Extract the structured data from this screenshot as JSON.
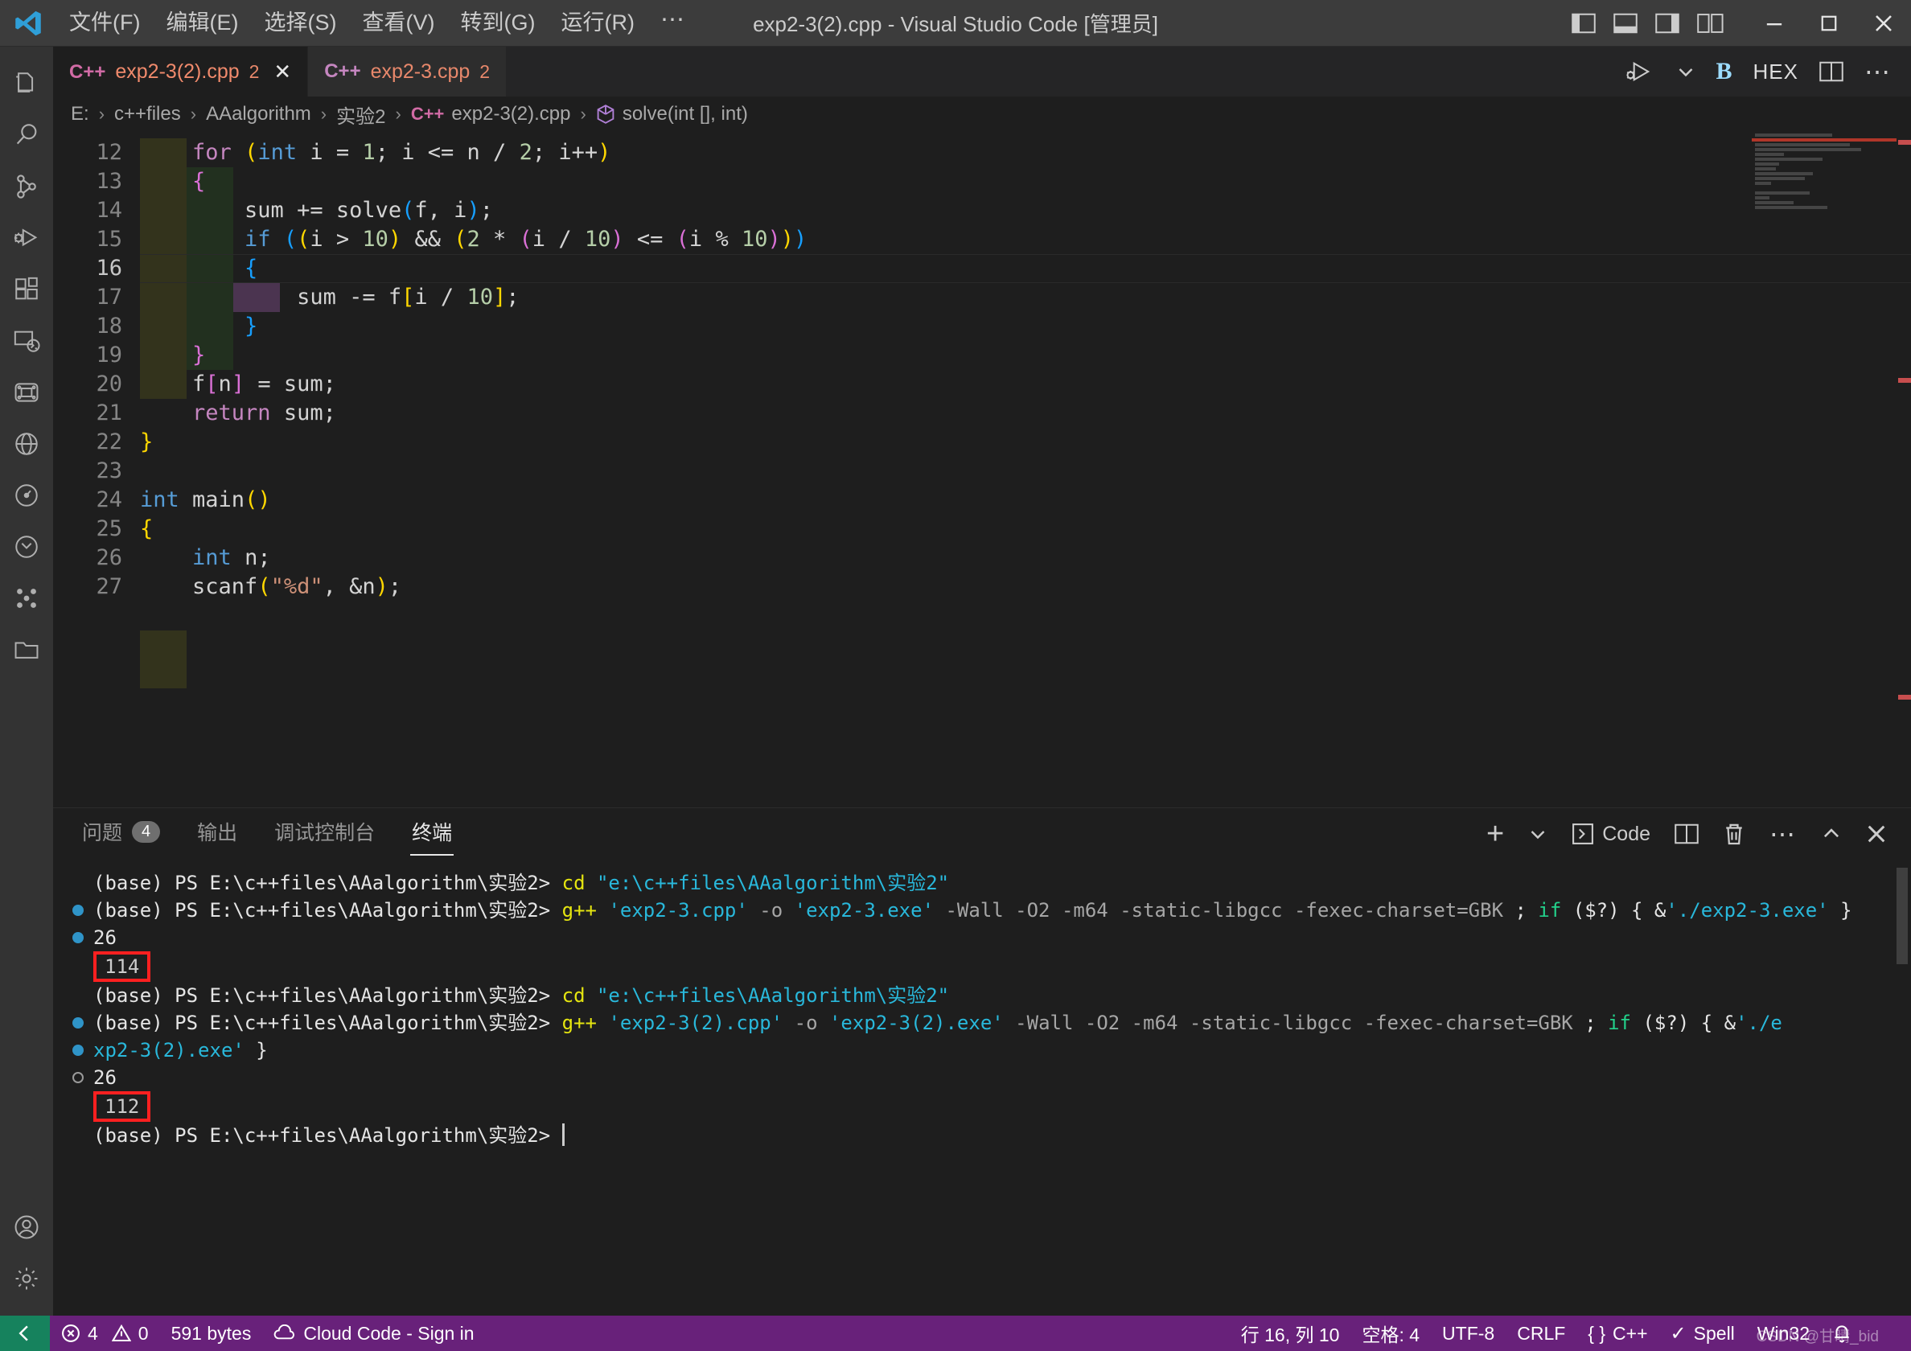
{
  "window": {
    "title": "exp2-3(2).cpp - Visual Studio Code [管理员]",
    "menu": [
      "文件(F)",
      "编辑(E)",
      "选择(S)",
      "查看(V)",
      "转到(G)",
      "运行(R)",
      "⋯"
    ],
    "controls": {
      "minimize": "—",
      "maximize": "▢",
      "close": "✕"
    }
  },
  "activitybar": {
    "items": [
      {
        "name": "explorer-icon",
        "label": "资源管理器"
      },
      {
        "name": "search-icon",
        "label": "搜索"
      },
      {
        "name": "source-control-icon",
        "label": "源代码管理"
      },
      {
        "name": "run-debug-icon",
        "label": "运行和调试"
      },
      {
        "name": "extensions-icon",
        "label": "扩展"
      },
      {
        "name": "remote-explorer-icon",
        "label": "远程资源管理器"
      },
      {
        "name": "testing-icon",
        "label": "测试"
      },
      {
        "name": "cloud-code-icon",
        "label": "Cloud Code"
      },
      {
        "name": "gauge-icon",
        "label": "性能"
      },
      {
        "name": "beaker-icon",
        "label": "实验"
      },
      {
        "name": "blocks-icon",
        "label": "模块"
      },
      {
        "name": "folder-icon",
        "label": "文件夹"
      },
      {
        "name": "account-icon",
        "label": "账户"
      },
      {
        "name": "settings-gear-icon",
        "label": "管理"
      }
    ]
  },
  "tabs": [
    {
      "icon_label": "C++",
      "name": "exp2-3(2).cpp",
      "problems": "2",
      "active": true,
      "close": "✕"
    },
    {
      "icon_label": "C++",
      "name": "exp2-3.cpp",
      "problems": "2",
      "active": false,
      "close": ""
    }
  ],
  "editor_actions": [
    {
      "name": "run-and-debug-icon",
      "label": "运行和调试"
    },
    {
      "name": "chevron-down-icon",
      "label": "更多运行选项"
    },
    {
      "name": "bold-b-icon",
      "label": "B"
    },
    {
      "name": "hex-editor-icon",
      "label": "HEX"
    },
    {
      "name": "split-editor-icon",
      "label": "拆分编辑器"
    },
    {
      "name": "more-actions-icon",
      "label": "⋯"
    }
  ],
  "breadcrumb": {
    "parts": [
      "E:",
      "c++files",
      "AAalgorithm",
      "实验2",
      "exp2-3(2).cpp",
      "solve(int [], int)"
    ],
    "separator": "›",
    "file_icon": "C++",
    "symbol_icon": "method-symbol-icon"
  },
  "code": {
    "first_line": 12,
    "lines": [
      {
        "n": 12,
        "tokens": [
          {
            "t": "    ",
            "c": "plain"
          },
          {
            "t": "for",
            "c": "ctrl"
          },
          {
            "t": " ",
            "c": "plain"
          },
          {
            "t": "(",
            "c": "b1"
          },
          {
            "t": "int",
            "c": "blue"
          },
          {
            "t": " i ",
            "c": "plain"
          },
          {
            "t": "=",
            "c": "plain"
          },
          {
            "t": " ",
            "c": "plain"
          },
          {
            "t": "1",
            "c": "num"
          },
          {
            "t": "; i ",
            "c": "plain"
          },
          {
            "t": "<=",
            "c": "plain"
          },
          {
            "t": " n ",
            "c": "plain"
          },
          {
            "t": "/",
            "c": "plain"
          },
          {
            "t": " ",
            "c": "plain"
          },
          {
            "t": "2",
            "c": "num"
          },
          {
            "t": "; i",
            "c": "plain"
          },
          {
            "t": "++",
            "c": "plain"
          },
          {
            "t": ")",
            "c": "b1"
          }
        ]
      },
      {
        "n": 13,
        "tokens": [
          {
            "t": "    ",
            "c": "plain"
          },
          {
            "t": "{",
            "c": "b2"
          }
        ]
      },
      {
        "n": 14,
        "tokens": [
          {
            "t": "        sum ",
            "c": "plain"
          },
          {
            "t": "+=",
            "c": "plain"
          },
          {
            "t": " solve",
            "c": "plain"
          },
          {
            "t": "(",
            "c": "b3"
          },
          {
            "t": "f, i",
            "c": "plain"
          },
          {
            "t": ")",
            "c": "b3"
          },
          {
            "t": ";",
            "c": "plain"
          }
        ]
      },
      {
        "n": 15,
        "tokens": [
          {
            "t": "        ",
            "c": "plain"
          },
          {
            "t": "if",
            "c": "blue"
          },
          {
            "t": " ",
            "c": "plain"
          },
          {
            "t": "(",
            "c": "b3"
          },
          {
            "t": "(",
            "c": "b1"
          },
          {
            "t": "i ",
            "c": "plain"
          },
          {
            "t": ">",
            "c": "plain"
          },
          {
            "t": " ",
            "c": "plain"
          },
          {
            "t": "10",
            "c": "num"
          },
          {
            "t": ")",
            "c": "b1"
          },
          {
            "t": " && ",
            "c": "plain"
          },
          {
            "t": "(",
            "c": "b1"
          },
          {
            "t": "2",
            "c": "num"
          },
          {
            "t": " * ",
            "c": "plain"
          },
          {
            "t": "(",
            "c": "b2"
          },
          {
            "t": "i ",
            "c": "plain"
          },
          {
            "t": "/",
            "c": "plain"
          },
          {
            "t": " ",
            "c": "plain"
          },
          {
            "t": "10",
            "c": "num"
          },
          {
            "t": ")",
            "c": "b2"
          },
          {
            "t": " <= ",
            "c": "plain"
          },
          {
            "t": "(",
            "c": "b2"
          },
          {
            "t": "i ",
            "c": "plain"
          },
          {
            "t": "%",
            "c": "plain"
          },
          {
            "t": " ",
            "c": "plain"
          },
          {
            "t": "10",
            "c": "num"
          },
          {
            "t": ")",
            "c": "b2"
          },
          {
            "t": ")",
            "c": "b1"
          },
          {
            "t": ")",
            "c": "b3"
          }
        ]
      },
      {
        "n": 16,
        "tokens": [
          {
            "t": "        ",
            "c": "plain"
          },
          {
            "t": "{",
            "c": "b3"
          }
        ],
        "current": true
      },
      {
        "n": 17,
        "tokens": [
          {
            "t": "            sum ",
            "c": "plain"
          },
          {
            "t": "-=",
            "c": "plain"
          },
          {
            "t": " f",
            "c": "plain"
          },
          {
            "t": "[",
            "c": "b1"
          },
          {
            "t": "i ",
            "c": "plain"
          },
          {
            "t": "/",
            "c": "plain"
          },
          {
            "t": " ",
            "c": "plain"
          },
          {
            "t": "10",
            "c": "num"
          },
          {
            "t": "]",
            "c": "b1"
          },
          {
            "t": ";",
            "c": "plain"
          }
        ]
      },
      {
        "n": 18,
        "tokens": [
          {
            "t": "        ",
            "c": "plain"
          },
          {
            "t": "}",
            "c": "b3"
          }
        ]
      },
      {
        "n": 19,
        "tokens": [
          {
            "t": "    ",
            "c": "plain"
          },
          {
            "t": "}",
            "c": "b2"
          }
        ]
      },
      {
        "n": 20,
        "tokens": [
          {
            "t": "    f",
            "c": "plain"
          },
          {
            "t": "[",
            "c": "b2"
          },
          {
            "t": "n",
            "c": "plain"
          },
          {
            "t": "]",
            "c": "b2"
          },
          {
            "t": " = sum;",
            "c": "plain"
          }
        ]
      },
      {
        "n": 21,
        "tokens": [
          {
            "t": "    ",
            "c": "plain"
          },
          {
            "t": "return",
            "c": "ctrl"
          },
          {
            "t": " sum;",
            "c": "plain"
          }
        ]
      },
      {
        "n": 22,
        "tokens": [
          {
            "t": "}",
            "c": "b1"
          }
        ]
      },
      {
        "n": 23,
        "tokens": [
          {
            "t": "",
            "c": "plain"
          }
        ]
      },
      {
        "n": 24,
        "tokens": [
          {
            "t": "int",
            "c": "blue"
          },
          {
            "t": " main",
            "c": "plain"
          },
          {
            "t": "(",
            "c": "b1"
          },
          {
            "t": ")",
            "c": "b1"
          }
        ]
      },
      {
        "n": 25,
        "tokens": [
          {
            "t": "{",
            "c": "b1"
          }
        ]
      },
      {
        "n": 26,
        "tokens": [
          {
            "t": "    ",
            "c": "plain"
          },
          {
            "t": "int",
            "c": "blue"
          },
          {
            "t": " n;",
            "c": "plain"
          }
        ]
      },
      {
        "n": 27,
        "tokens": [
          {
            "t": "    scanf",
            "c": "plain"
          },
          {
            "t": "(",
            "c": "b1"
          },
          {
            "t": "\"%d\"",
            "c": "str"
          },
          {
            "t": ", &n",
            "c": "plain"
          },
          {
            "t": ")",
            "c": "b1"
          },
          {
            "t": ";",
            "c": "plain"
          }
        ]
      }
    ]
  },
  "panel": {
    "tabs": [
      {
        "label": "问题",
        "badge": "4",
        "active": false
      },
      {
        "label": "输出",
        "badge": "",
        "active": false
      },
      {
        "label": "调试控制台",
        "badge": "",
        "active": false
      },
      {
        "label": "终端",
        "badge": "",
        "active": true
      }
    ],
    "actions": [
      {
        "name": "new-terminal-icon",
        "label": "+"
      },
      {
        "name": "chevron-down-icon",
        "label": "⌄"
      },
      {
        "name": "terminal-code-icon",
        "label": "Code"
      },
      {
        "name": "split-terminal-icon",
        "label": ""
      },
      {
        "name": "kill-terminal-icon",
        "label": ""
      },
      {
        "name": "terminal-more-icon",
        "label": "⋯"
      },
      {
        "name": "maximize-panel-icon",
        "label": "^"
      },
      {
        "name": "close-panel-icon",
        "label": "✕"
      }
    ]
  },
  "terminal": {
    "prompt": "(base) PS E:\\c++files\\AAalgorithm\\实验2> ",
    "lines": [
      {
        "mark": "none",
        "segments": [
          {
            "t": "(base) PS E:\\c++files\\AAalgorithm\\实验2> ",
            "c": "white"
          },
          {
            "t": "cd",
            "c": "yellow"
          },
          {
            "t": " ",
            "c": "white"
          },
          {
            "t": "\"e:\\c++files\\AAalgorithm\\实验2\"",
            "c": "cyan"
          }
        ]
      },
      {
        "mark": "blue",
        "segments": [
          {
            "t": "(base) PS E:\\c++files\\AAalgorithm\\实验2> ",
            "c": "white"
          },
          {
            "t": "g++",
            "c": "yellow"
          },
          {
            "t": " ",
            "c": "white"
          },
          {
            "t": "'exp2-3.cpp'",
            "c": "cyan"
          },
          {
            "t": " -o ",
            "c": "gray"
          },
          {
            "t": "'exp2-3.exe'",
            "c": "cyan"
          },
          {
            "t": " -Wall -O2 -m64 -static-libgcc -fexec-charset=GBK ",
            "c": "gray"
          },
          {
            "t": ";",
            "c": "white"
          },
          {
            "t": " ",
            "c": "white"
          },
          {
            "t": "if",
            "c": "green"
          },
          {
            "t": " ($?) { &",
            "c": "white"
          },
          {
            "t": "'./exp2-3.exe'",
            "c": "cyan"
          },
          {
            "t": " }",
            "c": "white"
          }
        ]
      },
      {
        "mark": "blue",
        "segments": [
          {
            "t": "26",
            "c": "white"
          }
        ]
      },
      {
        "mark": "none",
        "boxed": "114",
        "segments": []
      },
      {
        "mark": "none",
        "segments": [
          {
            "t": "(base) PS E:\\c++files\\AAalgorithm\\实验2> ",
            "c": "white"
          },
          {
            "t": "cd",
            "c": "yellow"
          },
          {
            "t": " ",
            "c": "white"
          },
          {
            "t": "\"e:\\c++files\\AAalgorithm\\实验2\"",
            "c": "cyan"
          }
        ]
      },
      {
        "mark": "blue",
        "segments": [
          {
            "t": "(base) PS E:\\c++files\\AAalgorithm\\实验2> ",
            "c": "white"
          },
          {
            "t": "g++",
            "c": "yellow"
          },
          {
            "t": " ",
            "c": "white"
          },
          {
            "t": "'exp2-3(2).cpp'",
            "c": "cyan"
          },
          {
            "t": " -o ",
            "c": "gray"
          },
          {
            "t": "'exp2-3(2).exe'",
            "c": "cyan"
          },
          {
            "t": " -Wall -O2 -m64 -static-libgcc -fexec-charset=GBK ",
            "c": "gray"
          },
          {
            "t": ";",
            "c": "white"
          },
          {
            "t": " ",
            "c": "white"
          },
          {
            "t": "if",
            "c": "green"
          },
          {
            "t": " ($?) { &",
            "c": "white"
          },
          {
            "t": "'./e",
            "c": "cyan"
          }
        ]
      },
      {
        "mark": "blue",
        "segments": [
          {
            "t": "xp2-3(2).exe'",
            "c": "cyan"
          },
          {
            "t": " }",
            "c": "white"
          }
        ]
      },
      {
        "mark": "hollow",
        "segments": [
          {
            "t": "26",
            "c": "white"
          }
        ]
      },
      {
        "mark": "none",
        "boxed": "112",
        "segments": []
      },
      {
        "mark": "none",
        "cursor": true,
        "segments": [
          {
            "t": "(base) PS E:\\c++files\\AAalgorithm\\实验2> ",
            "c": "white"
          }
        ]
      }
    ]
  },
  "statusbar": {
    "remote_icon": "remote-window-icon",
    "left": [
      {
        "name": "problems-status",
        "icon": "error-icon",
        "text": "4",
        "icon2": "warning-icon",
        "text2": "0"
      },
      {
        "name": "file-size-status",
        "text": "591 bytes"
      },
      {
        "name": "cloud-code-status",
        "icon": "cloud-icon",
        "text": "Cloud Code - Sign in"
      }
    ],
    "right": [
      {
        "name": "cursor-position-status",
        "text": "行 16, 列 10"
      },
      {
        "name": "indentation-status",
        "text": "空格: 4"
      },
      {
        "name": "encoding-status",
        "text": "UTF-8"
      },
      {
        "name": "eol-status",
        "text": "CRLF"
      },
      {
        "name": "language-mode-status",
        "text": "C++",
        "icon": "braces-icon"
      },
      {
        "name": "spell-checker-status",
        "text": "Spell",
        "icon": "check-icon"
      },
      {
        "name": "platform-status",
        "text": "Win32"
      },
      {
        "name": "notifications-status",
        "icon": "bell-icon",
        "text": ""
      }
    ],
    "watermark": "CSDN @甘晴_bid"
  },
  "colors": {
    "statusbar": "#68217a",
    "remote": "#16825d",
    "titlebar": "#3c3c3c",
    "activitybar": "#333333",
    "editor": "#1e1e1e",
    "annotation_red": "#ff2020"
  }
}
